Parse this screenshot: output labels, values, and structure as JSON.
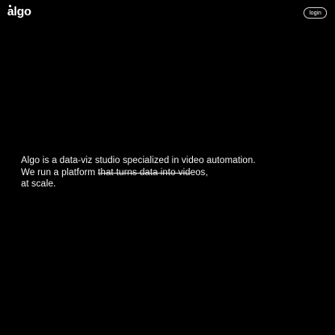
{
  "header": {
    "logo_text": "algo",
    "login_label": "login"
  },
  "hero": {
    "line1": "Algo is a data-viz studio specialized in video automation.",
    "line2_prefix": "We run a platform ",
    "line2_strike": "that turns data into vid",
    "line2_suffix": "eos,",
    "line3": "at scale."
  },
  "colors": {
    "background": "#000000",
    "text": "#ffffff",
    "button_border": "#cfcfcf"
  }
}
